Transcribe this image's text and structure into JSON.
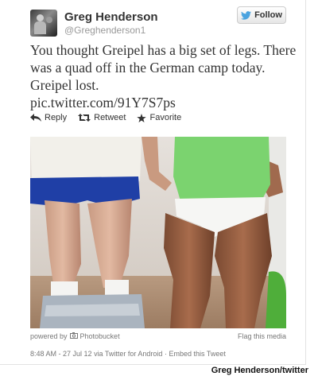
{
  "author": {
    "display_name": "Greg Henderson",
    "screen_name": "@Greghenderson1"
  },
  "follow_button": {
    "label": "Follow"
  },
  "tweet": {
    "text": "You thought Greipel has a big set of legs. There was a quad off in the German camp today. Greipel lost.",
    "link": "pic.twitter.com/91Y7S7ps"
  },
  "actions": {
    "reply": "Reply",
    "retweet": "Retweet",
    "favorite": "Favorite"
  },
  "media_footer": {
    "powered_by": "powered by",
    "provider": "Photobucket",
    "flag": "Flag this media"
  },
  "meta": {
    "timestamp": "8:48 AM - 27 Jul 12",
    "via": "via Twitter for Android",
    "separator": "·",
    "embed": "Embed this Tweet"
  },
  "photo_credit": "Greg Henderson/twitter",
  "colors": {
    "twitter_blue": "#4aa3df",
    "text": "#333333",
    "muted": "#777777"
  }
}
